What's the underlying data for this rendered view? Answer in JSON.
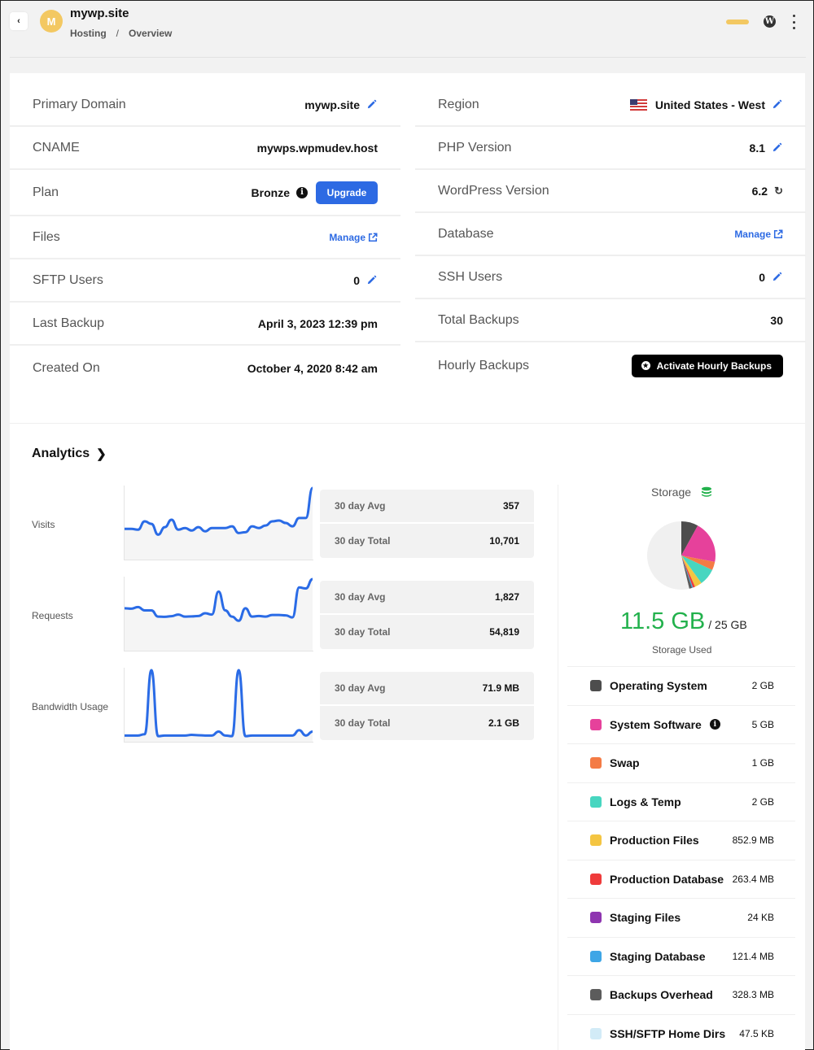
{
  "header": {
    "avatar_letter": "M",
    "site_title": "mywp.site",
    "breadcrumb": [
      "Hosting",
      "/",
      "Overview"
    ],
    "status_color": "#f3c862",
    "wp_glyph": "W"
  },
  "details_left": [
    {
      "label": "Primary Domain",
      "value": "mywp.site",
      "action": "edit"
    },
    {
      "label": "CNAME",
      "value": "mywps.wpmudev.host"
    },
    {
      "label": "Plan",
      "value": "Bronze",
      "info": true,
      "button": "Upgrade"
    },
    {
      "label": "Files",
      "link": "Manage"
    },
    {
      "label": "SFTP Users",
      "value": "0",
      "action": "edit"
    },
    {
      "label": "Last Backup",
      "value": "April 3, 2023 12:39 pm"
    },
    {
      "label": "Created On",
      "value": "October 4, 2020 8:42 am"
    }
  ],
  "details_right": [
    {
      "label": "Region",
      "value": "United States - West",
      "flag": "us",
      "action": "edit"
    },
    {
      "label": "PHP Version",
      "value": "8.1",
      "action": "edit"
    },
    {
      "label": "WordPress Version",
      "value": "6.2",
      "action": "refresh"
    },
    {
      "label": "Database",
      "link": "Manage"
    },
    {
      "label": "SSH Users",
      "value": "0",
      "action": "edit"
    },
    {
      "label": "Total Backups",
      "value": "30"
    },
    {
      "label": "Hourly Backups",
      "button": "Activate Hourly Backups"
    }
  ],
  "analytics": {
    "title": "Analytics",
    "metrics": [
      {
        "name": "Visits",
        "avg_label": "30 day Avg",
        "avg": "357",
        "total_label": "30 day Total",
        "total": "10,701",
        "series": [
          310,
          310,
          300,
          400,
          370,
          240,
          330,
          420,
          300,
          320,
          290,
          330,
          280,
          320,
          320,
          320,
          340,
          260,
          270,
          340,
          320,
          350,
          400,
          410,
          380,
          340,
          440,
          440,
          800
        ]
      },
      {
        "name": "Requests",
        "avg_label": "30 day Avg",
        "avg": "1,827",
        "total_label": "30 day Total",
        "total": "54,819",
        "series": [
          1800,
          1780,
          1860,
          1700,
          1700,
          1400,
          1390,
          1420,
          1500,
          1400,
          1410,
          1430,
          1560,
          1500,
          2600,
          1700,
          1400,
          1200,
          1800,
          1400,
          1430,
          1400,
          1480,
          1480,
          1460,
          1360,
          2800,
          2750,
          3200
        ]
      },
      {
        "name": "Bandwidth Usage",
        "avg_label": "30 day Avg",
        "avg": "71.9 MB",
        "total_label": "30 day Total",
        "total": "2.1 GB",
        "series": [
          20,
          20,
          20,
          40,
          1000,
          10,
          20,
          20,
          20,
          20,
          30,
          25,
          20,
          20,
          80,
          20,
          10,
          1000,
          10,
          20,
          20,
          20,
          20,
          20,
          20,
          20,
          100,
          20,
          80
        ]
      }
    ]
  },
  "storage": {
    "title": "Storage",
    "used": "11.5 GB",
    "total": "/ 25 GB",
    "used_label": "Storage Used",
    "used_fraction": 0.46,
    "free_color": "#f0f0f0",
    "items": [
      {
        "name": "Operating System",
        "size": "2 GB",
        "gb": 2,
        "color": "#4d4d4d"
      },
      {
        "name": "System Software",
        "size": "5 GB",
        "gb": 5,
        "color": "#e6419b",
        "info": true
      },
      {
        "name": "Swap",
        "size": "1 GB",
        "gb": 1,
        "color": "#f47b45"
      },
      {
        "name": "Logs & Temp",
        "size": "2 GB",
        "gb": 2,
        "color": "#47d6c0"
      },
      {
        "name": "Production Files",
        "size": "852.9 MB",
        "gb": 0.8529,
        "color": "#f4c542"
      },
      {
        "name": "Production Database",
        "size": "263.4 MB",
        "gb": 0.2634,
        "color": "#ef3b3b"
      },
      {
        "name": "Staging Files",
        "size": "24 KB",
        "gb": 2.4e-05,
        "color": "#8e35b0"
      },
      {
        "name": "Staging Database",
        "size": "121.4 MB",
        "gb": 0.1214,
        "color": "#3ea6e6"
      },
      {
        "name": "Backups Overhead",
        "size": "328.3 MB",
        "gb": 0.3283,
        "color": "#5c5c5c"
      },
      {
        "name": "SSH/SFTP Home Dirs",
        "size": "47.5 KB",
        "gb": 4.75e-05,
        "color": "#d2ebf7"
      }
    ],
    "capacity_gb": 25
  }
}
